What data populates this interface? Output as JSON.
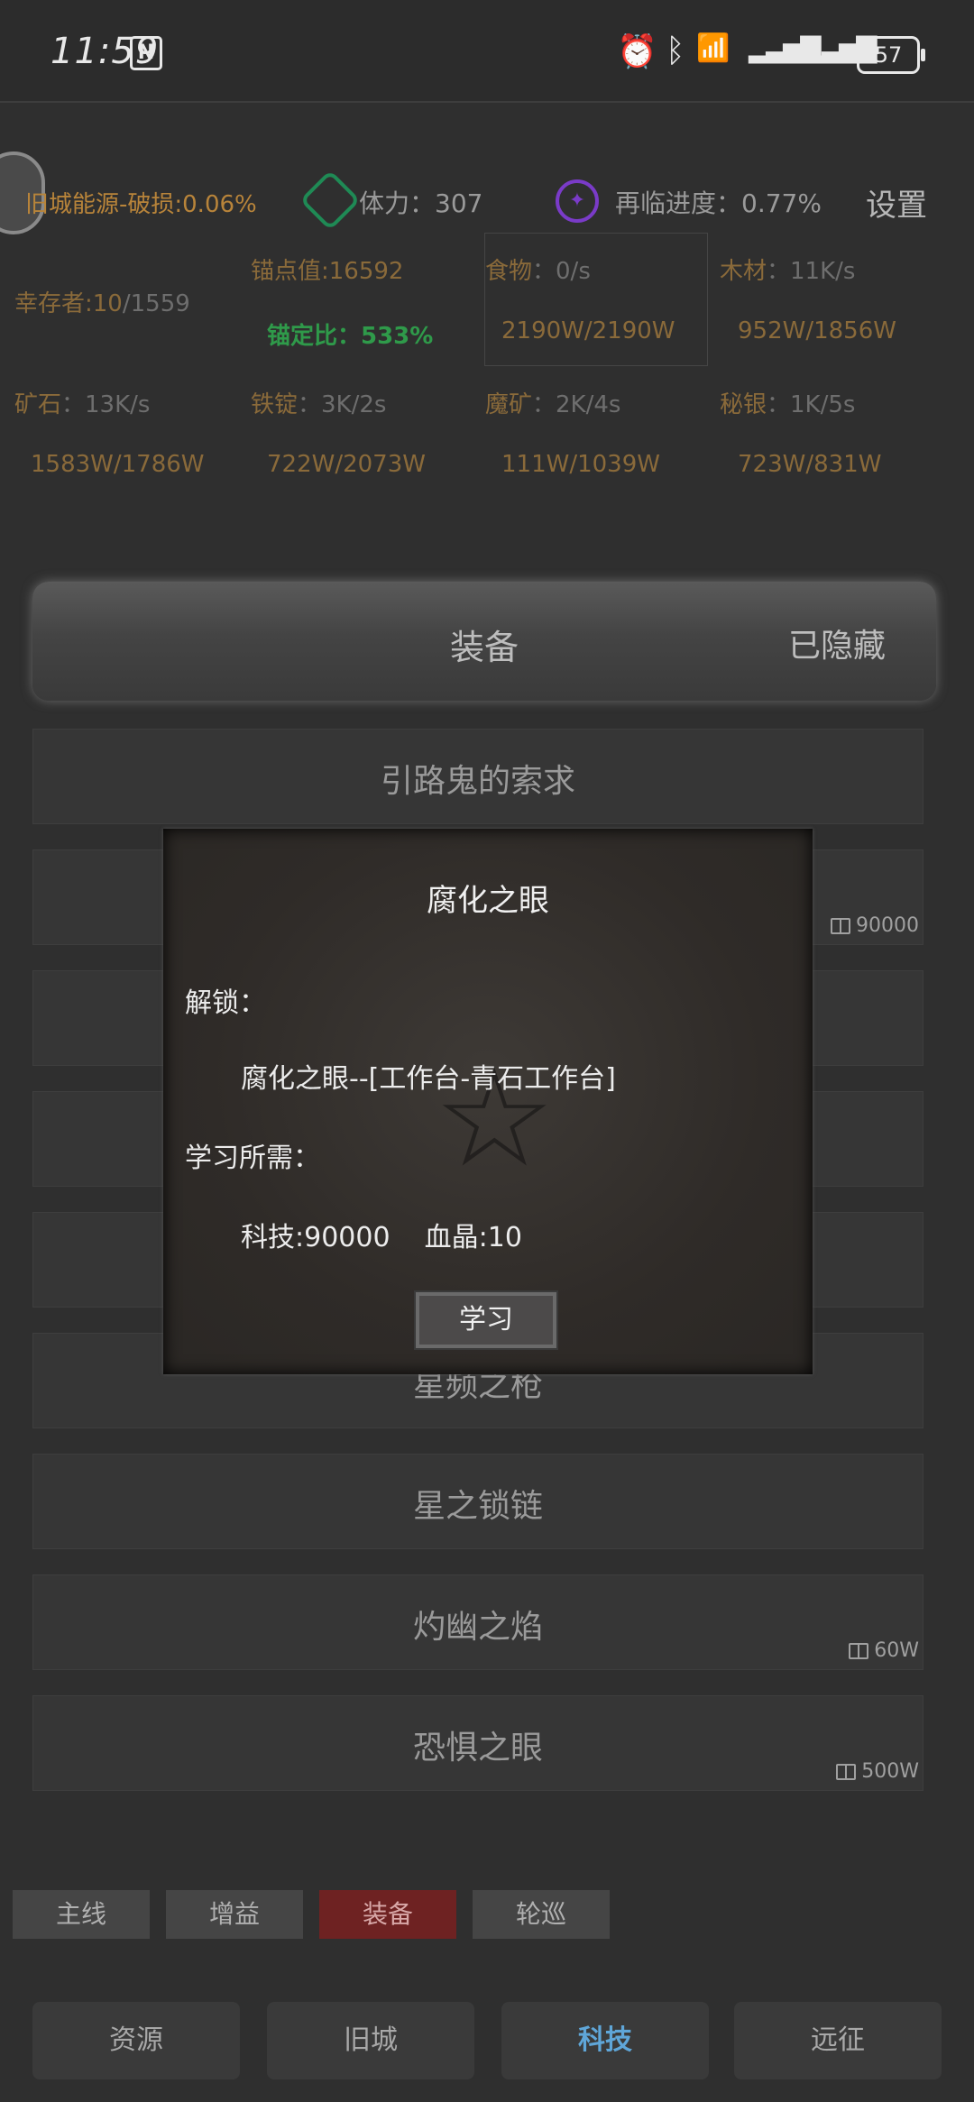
{
  "status": {
    "time": "11:59",
    "nfc": "N",
    "battery": "57"
  },
  "header": {
    "city_energy": "旧城能源-破损:0.06%",
    "stamina_label": "体力：",
    "stamina_value": "307",
    "revisit_label": "再临进度：",
    "revisit_value": "0.77%",
    "settings": "设置"
  },
  "resources": {
    "survivor_label": "幸存者:10",
    "survivor_max": "/1559",
    "anchor_value": "锚点值:16592",
    "anchor_ratio": "锚定比：533%",
    "food_label": "食物",
    "food_rate": "：0/s",
    "food_amount": "2190W/2190W",
    "wood_label": "木材",
    "wood_rate": "：11K/s",
    "wood_amount": "952W/1856W",
    "ore_label": "矿石",
    "ore_rate": "：13K/s",
    "ore_amount": "1583W/1786W",
    "ingot_label": "铁锭",
    "ingot_rate": "：3K/2s",
    "ingot_amount": "722W/2073W",
    "magic_ore_label": "魔矿",
    "magic_ore_rate": "：2K/4s",
    "magic_ore_amount": "111W/1039W",
    "mithril_label": "秘银",
    "mithril_rate": "：1K/5s",
    "mithril_amount": "723W/831W"
  },
  "banner": {
    "title": "装备",
    "right": "已隐藏"
  },
  "cards": [
    {
      "title": "引路鬼的索求",
      "cost": ""
    },
    {
      "title": "",
      "cost": "90000"
    },
    {
      "title": "",
      "cost": ""
    },
    {
      "title": "",
      "cost": ""
    },
    {
      "title": "",
      "cost": ""
    },
    {
      "title": "星频之枪",
      "cost": ""
    },
    {
      "title": "星之锁链",
      "cost": ""
    },
    {
      "title": "灼幽之焰",
      "cost": "60W"
    },
    {
      "title": "恐惧之眼",
      "cost": "500W"
    }
  ],
  "modal": {
    "title": "腐化之眼",
    "unlock_label": "解锁：",
    "unlock_value": "腐化之眼--[工作台-青石工作台]",
    "require_label": "学习所需：",
    "require_value": "科技:90000    血晶:10",
    "learn_button": "学习"
  },
  "tabs": [
    "主线",
    "增益",
    "装备",
    "轮巡"
  ],
  "nav": [
    "资源",
    "旧城",
    "科技",
    "远征"
  ],
  "colors": {
    "active_tab": "#6e2222",
    "active_nav": "#5fa6d8",
    "anchor_ratio": "#2f9a4a"
  }
}
